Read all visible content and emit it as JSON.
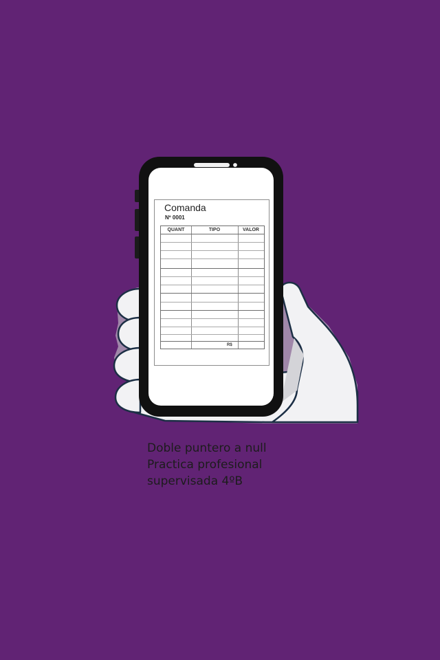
{
  "receipt": {
    "title": "Comanda",
    "number": "Nº 0001",
    "columns": [
      "QUANT",
      "TIPO",
      "VALOR"
    ],
    "total_label": "R$"
  },
  "caption": {
    "line1": "Doble puntero a null",
    "line2": "Practica profesional",
    "line3": "supervisada 4ºB"
  },
  "colors": {
    "background": "#612374",
    "hand": "#f4f4f6",
    "phone": "#111111"
  },
  "icons": [
    "hand-icon",
    "smartphone-icon",
    "camera-icon"
  ]
}
